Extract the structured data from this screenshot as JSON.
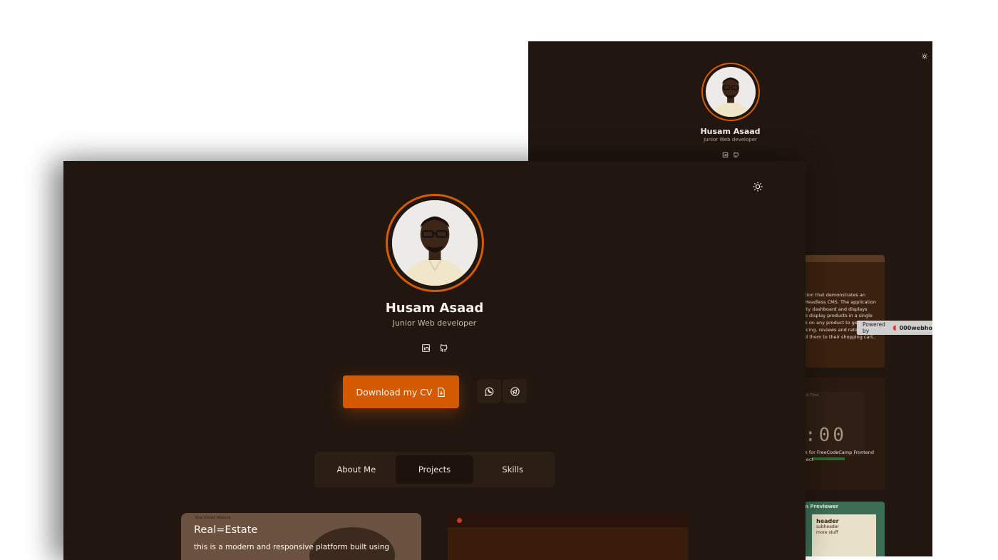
{
  "back_window": {
    "name": "Husam Asaad",
    "role": "Junior Web developer",
    "card_a_text": "tion that demonstrates an\n Headless CMS. The application\nity dashboard and displays\no display products in a single\nk on any product to get more\nicing, reviews and rating. Users\nd them to their shopping cart..",
    "card_b_label": "ck Time",
    "card_b_digits": ":00",
    "card_b_caption": "k for FreeCodeCamp Frontend\nject",
    "card_c_header": "n Previewer",
    "card_c_lines": [
      "header",
      "subheader",
      "more stuff"
    ]
  },
  "hosting_badge": {
    "label": "Powered by",
    "brand": "000webho"
  },
  "profile": {
    "name": "Husam Asaad",
    "role": "Junior Web developer"
  },
  "actions": {
    "download_cv": "Download my CV"
  },
  "tabs": [
    {
      "label": "About Me",
      "active": false
    },
    {
      "label": "Projects",
      "active": true
    },
    {
      "label": "Skills",
      "active": false
    }
  ],
  "projects": [
    {
      "thumb_label": "Real Estate Website",
      "title": "Real=Estate",
      "description": "this is a modern and responsive platform built using"
    }
  ],
  "colors": {
    "background": "#221710",
    "accent": "#d55b00",
    "surface": "#2b1e15"
  }
}
